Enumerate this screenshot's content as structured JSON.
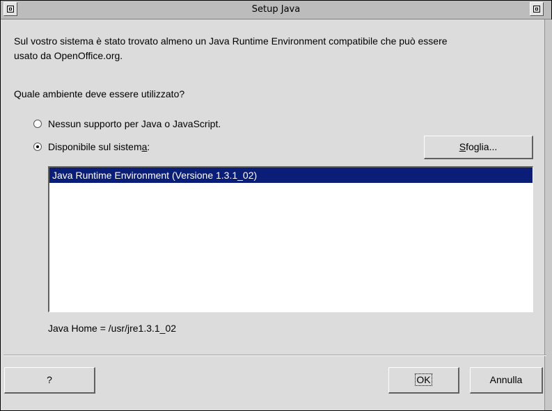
{
  "window": {
    "title": "Setup Java"
  },
  "dialog": {
    "intro_line1": "Sul vostro sistema è stato trovato almeno un Java Runtime Environment compatibile che può essere",
    "intro_line2": "usato da OpenOffice.org.",
    "question": "Quale ambiente deve essere utilizzato?",
    "options": [
      {
        "label": "Nessun supporto per Java o JavaScript.",
        "checked": false
      },
      {
        "label_pre": "Disponibile sul sistem",
        "label_mnemonic": "a",
        "label_post": ":",
        "checked": true
      }
    ],
    "browse_button": {
      "mnemonic": "S",
      "rest": "foglia..."
    },
    "jre_list": [
      {
        "label": "Java Runtime Environment (Versione 1.3.1_02)",
        "selected": true
      }
    ],
    "java_home": "Java Home = /usr/jre1.3.1_02",
    "buttons": {
      "help": "?",
      "ok": "OK",
      "cancel": "Annulla"
    }
  },
  "colors": {
    "selection": "#0a1e78",
    "dialog_bg": "#dcdcdc",
    "titlebar_bg": "#bcbcbc"
  }
}
